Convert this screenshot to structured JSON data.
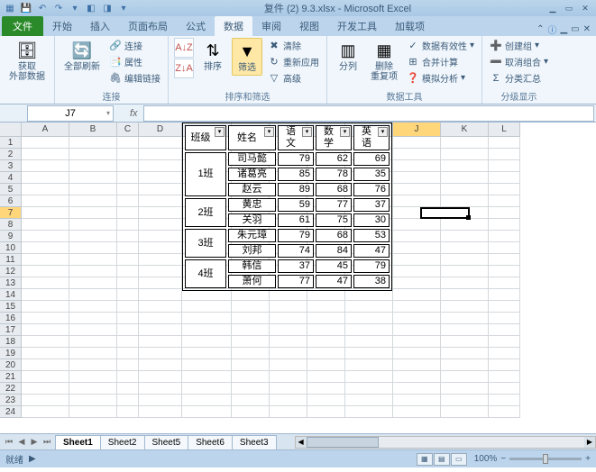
{
  "title": "复件 (2) 9.3.xlsx - Microsoft Excel",
  "tabs": {
    "file": "文件",
    "home": "开始",
    "insert": "插入",
    "layout": "页面布局",
    "formula": "公式",
    "data": "数据",
    "review": "审阅",
    "view": "视图",
    "dev": "开发工具",
    "addin": "加载项"
  },
  "ribbon": {
    "ext_data": {
      "get": "获取\n外部数据",
      "label": ""
    },
    "conn": {
      "refresh": "全部刷新",
      "connections": "连接",
      "properties": "属性",
      "editlinks": "编辑链接",
      "label": "连接"
    },
    "sort": {
      "sort": "排序",
      "filter": "筛选",
      "clear": "清除",
      "reapply": "重新应用",
      "adv": "高级",
      "label": "排序和筛选"
    },
    "tools": {
      "t2c": "分列",
      "dup": "删除\n重复项",
      "valid": "数据有效性",
      "consol": "合并计算",
      "whatif": "模拟分析",
      "label": "数据工具"
    },
    "outline": {
      "group": "创建组",
      "ungroup": "取消组合",
      "subtotal": "分类汇总",
      "label": "分级显示"
    }
  },
  "namebox": "J7",
  "cols": [
    "A",
    "B",
    "C",
    "D",
    "E",
    "F",
    "G",
    "H",
    "I",
    "J",
    "K",
    "L"
  ],
  "table": {
    "headers": [
      "班级",
      "姓名",
      "语文",
      "数学",
      "英语"
    ],
    "rows": [
      {
        "class": "1班",
        "span": 3,
        "name": "司马懿",
        "c": 79,
        "m": 62,
        "e": 69
      },
      {
        "name": "诸葛亮",
        "c": 85,
        "m": 78,
        "e": 35
      },
      {
        "name": "赵云",
        "c": 89,
        "m": 68,
        "e": 76
      },
      {
        "class": "2班",
        "span": 2,
        "name": "黄忠",
        "c": 59,
        "m": 77,
        "e": 37
      },
      {
        "name": "关羽",
        "c": 61,
        "m": 75,
        "e": 30
      },
      {
        "class": "3班",
        "span": 2,
        "name": "朱元璋",
        "c": 79,
        "m": 68,
        "e": 53
      },
      {
        "name": "刘邦",
        "c": 74,
        "m": 84,
        "e": 47
      },
      {
        "class": "4班",
        "span": 2,
        "name": "韩信",
        "c": 37,
        "m": 45,
        "e": 79
      },
      {
        "name": "萧何",
        "c": 77,
        "m": 47,
        "e": 38
      }
    ]
  },
  "sheets": [
    "Sheet1",
    "Sheet2",
    "Sheet5",
    "Sheet6",
    "Sheet3"
  ],
  "status": "就绪",
  "zoom": "100%"
}
